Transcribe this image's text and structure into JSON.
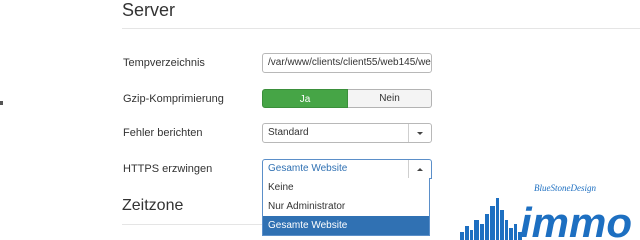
{
  "sections": {
    "server_title": "Server",
    "timezone_title": "Zeitzone"
  },
  "fields": {
    "temp_label": "Tempverzeichnis",
    "temp_value": "/var/www/clients/client55/web145/we",
    "gzip_label": "Gzip-Komprimierung",
    "gzip_yes": "Ja",
    "gzip_no": "Nein",
    "errors_label": "Fehler berichten",
    "errors_value": "Standard",
    "https_label": "HTTPS erzwingen",
    "https_value": "Gesamte Website"
  },
  "dropdown": {
    "options": [
      "Keine",
      "Nur Administrator",
      "Gesamte Website"
    ],
    "selected_index": 2
  },
  "watermark": {
    "brand_small": "BlueStoneDesign",
    "brand_large": "immo"
  },
  "colors": {
    "accent_green": "#46a546",
    "select_blue": "#3071b3",
    "logo_blue": "#1d6fc1"
  }
}
